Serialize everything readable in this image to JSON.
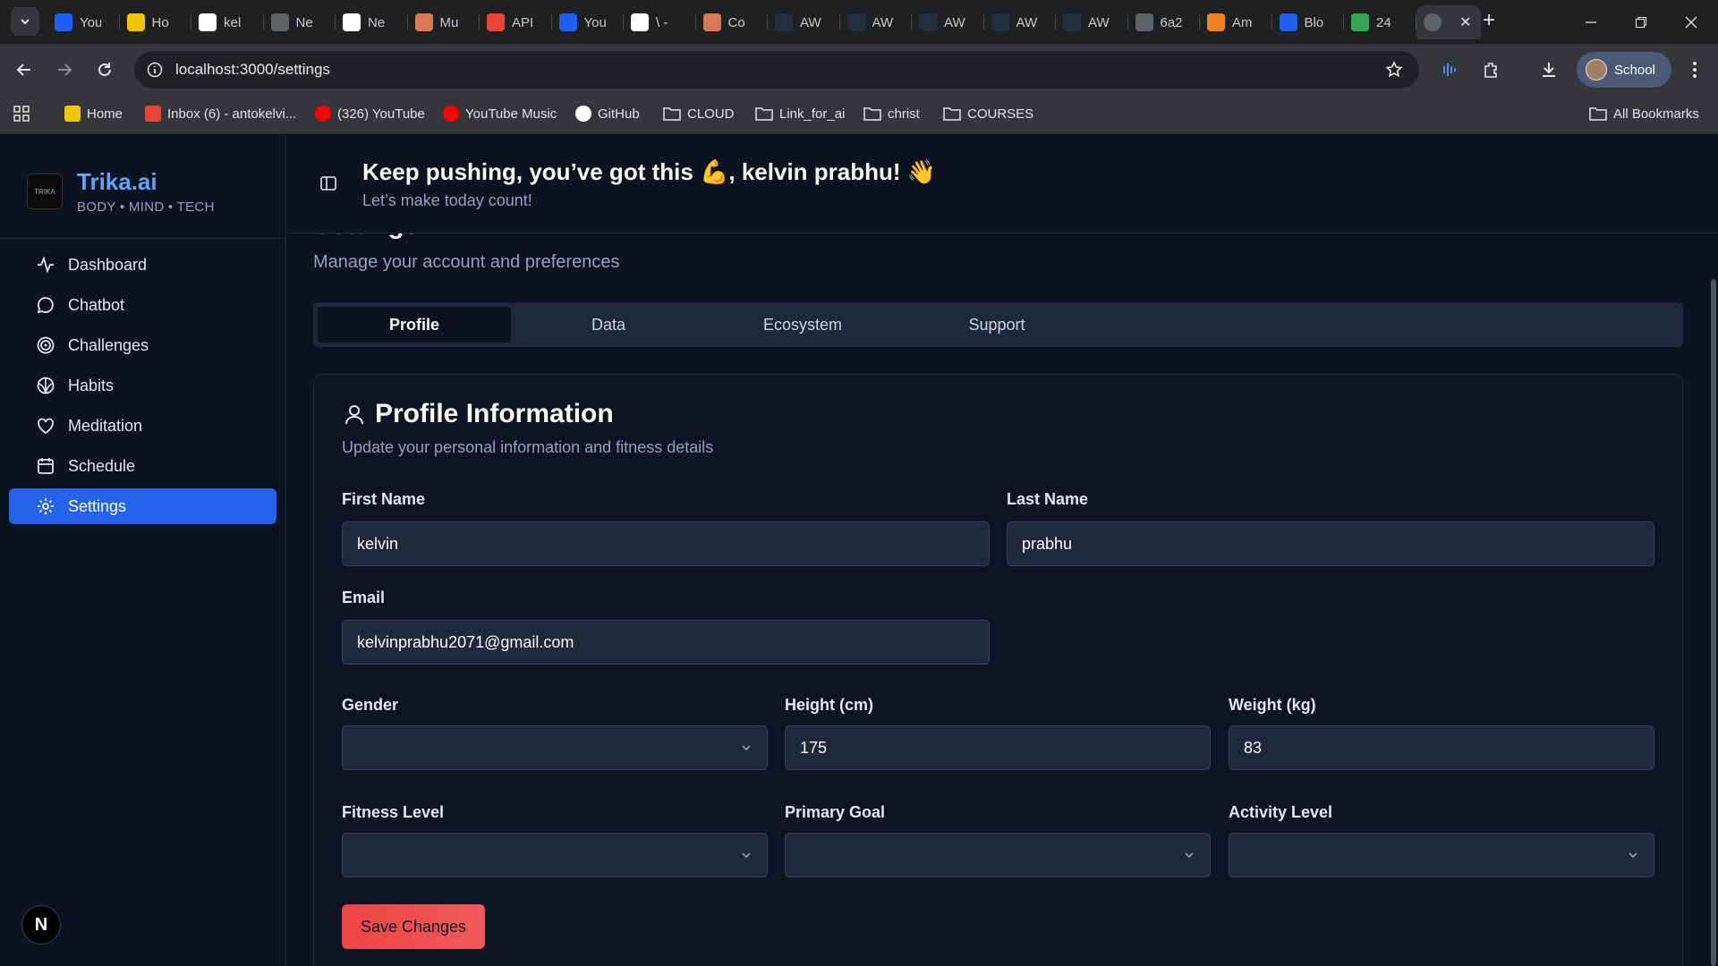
{
  "browser": {
    "tabs": [
      {
        "icon": "s-icon",
        "title": "You",
        "color": "#1e60f5"
      },
      {
        "icon": "home-icon",
        "title": "Ho",
        "color": "#f5c400"
      },
      {
        "icon": "github-icon",
        "title": "kel",
        "color": "#ffffff"
      },
      {
        "icon": "globe-icon",
        "title": "Ne",
        "color": "#5f6368"
      },
      {
        "icon": "openai-icon",
        "title": "Ne",
        "color": "#ffffff"
      },
      {
        "icon": "asterisk-icon",
        "title": "Mu",
        "color": "#d97757"
      },
      {
        "icon": "api-icon",
        "title": "API",
        "color": "#ea4335"
      },
      {
        "icon": "s-icon",
        "title": "You",
        "color": "#1e60f5"
      },
      {
        "icon": "google-icon",
        "title": "\\ -",
        "color": "#ffffff"
      },
      {
        "icon": "claude-icon",
        "title": "Co",
        "color": "#d97757"
      },
      {
        "icon": "aws-icon",
        "title": "AW",
        "color": "#232f3e"
      },
      {
        "icon": "aws-icon",
        "title": "AW",
        "color": "#232f3e"
      },
      {
        "icon": "aws-icon",
        "title": "AW",
        "color": "#232f3e"
      },
      {
        "icon": "aws-icon",
        "title": "AW",
        "color": "#232f3e"
      },
      {
        "icon": "aws-icon",
        "title": "AW",
        "color": "#232f3e"
      },
      {
        "icon": "globe-icon",
        "title": "6a2",
        "color": "#5f6368"
      },
      {
        "icon": "box-icon",
        "title": "Am",
        "color": "#f48120"
      },
      {
        "icon": "s-icon",
        "title": "Blo",
        "color": "#1e60f5"
      },
      {
        "icon": "drive-icon",
        "title": "24",
        "color": "#34a853"
      }
    ],
    "active_tab_close": "✕",
    "new_tab": "+",
    "url": "localhost:3000/settings",
    "profile_label": "School",
    "bookmarks": [
      {
        "icon": "home-icon",
        "label": "Home"
      },
      {
        "icon": "gmail-icon",
        "label": "Inbox (6) - antokelvi..."
      },
      {
        "icon": "youtube-icon",
        "label": "(326) YouTube"
      },
      {
        "icon": "youtube-music-icon",
        "label": "YouTube Music"
      },
      {
        "icon": "github-icon",
        "label": "GitHub"
      },
      {
        "icon": "folder-icon",
        "label": "CLOUD"
      },
      {
        "icon": "folder-icon",
        "label": "Link_for_ai"
      },
      {
        "icon": "folder-icon",
        "label": "christ"
      },
      {
        "icon": "folder-icon",
        "label": "COURSES"
      }
    ],
    "all_bookmarks": "All Bookmarks"
  },
  "app": {
    "brand_name": "Trika.ai",
    "brand_tagline": "BODY • MIND • TECH",
    "logo_text": "TRIKA",
    "nav": [
      {
        "label": "Dashboard",
        "icon": "activity-icon",
        "selected": false
      },
      {
        "label": "Chatbot",
        "icon": "chat-bubble-icon",
        "selected": false
      },
      {
        "label": "Challenges",
        "icon": "target-icon",
        "selected": false
      },
      {
        "label": "Habits",
        "icon": "ball-icon",
        "selected": false
      },
      {
        "label": "Meditation",
        "icon": "heart-icon",
        "selected": false
      },
      {
        "label": "Schedule",
        "icon": "calendar-icon",
        "selected": false
      },
      {
        "label": "Settings",
        "icon": "gear-icon",
        "selected": true
      }
    ],
    "avatar_letter": "N",
    "greeting": "Keep pushing, you’ve got this 💪, kelvin prabhu! 👋",
    "greeting_sub": "Let’s make today count!",
    "page_title": "Settings",
    "page_subtitle": "Manage your account and preferences",
    "tabs": [
      "Profile",
      "Data",
      "Ecosystem",
      "Support"
    ],
    "active_tab": "Profile",
    "profile": {
      "title": "Profile Information",
      "description": "Update your personal information and fitness details",
      "first_name_label": "First Name",
      "first_name": "kelvin",
      "last_name_label": "Last Name",
      "last_name": "prabhu",
      "email_label": "Email",
      "email": "kelvinprabhu2071@gmail.com",
      "gender_label": "Gender",
      "gender": "",
      "height_label": "Height (cm)",
      "height": "175",
      "weight_label": "Weight (kg)",
      "weight": "83",
      "fitness_level_label": "Fitness Level",
      "fitness_level": "",
      "primary_goal_label": "Primary Goal",
      "primary_goal": "",
      "activity_level_label": "Activity Level",
      "activity_level": "",
      "save_label": "Save Changes"
    },
    "colors": {
      "accent": "#2563eb",
      "brand": "#60a5fa",
      "save": "#ef4444"
    }
  }
}
